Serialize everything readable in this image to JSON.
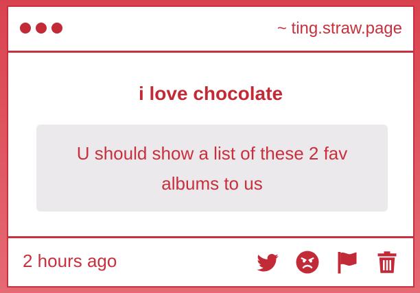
{
  "window": {
    "domain": "~ ting.straw.page"
  },
  "message": {
    "question": "i love chocolate",
    "answer": "U should show a list of these 2 fav albums to us"
  },
  "footer": {
    "timestamp": "2 hours ago",
    "actions": [
      {
        "icon": "twitter-icon"
      },
      {
        "icon": "angry-face-icon"
      },
      {
        "icon": "flag-icon"
      },
      {
        "icon": "trash-icon"
      }
    ]
  },
  "colors": {
    "accent": "#c8303d",
    "background": "#d9434f",
    "answer_box": "#ebe9eb"
  }
}
